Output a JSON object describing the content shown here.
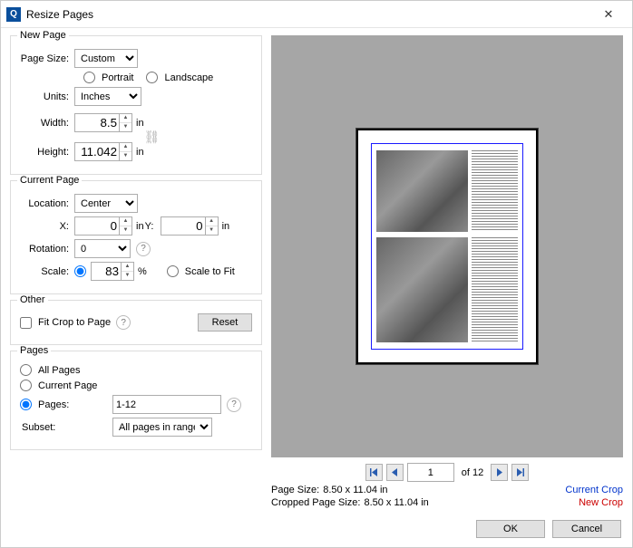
{
  "window": {
    "title": "Resize Pages"
  },
  "newPage": {
    "legend": "New Page",
    "pageSize_label": "Page Size:",
    "pageSize_value": "Custom",
    "portrait_label": "Portrait",
    "landscape_label": "Landscape",
    "units_label": "Units:",
    "units_value": "Inches",
    "width_label": "Width:",
    "width_value": "8.5",
    "width_unit": "in",
    "height_label": "Height:",
    "height_value": "11.042",
    "height_unit": "in"
  },
  "currentPage": {
    "legend": "Current Page",
    "location_label": "Location:",
    "location_value": "Center",
    "x_label": "X:",
    "x_value": "0",
    "x_unit": "in",
    "y_label": "Y:",
    "y_value": "0",
    "y_unit": "in",
    "rotation_label": "Rotation:",
    "rotation_value": "0",
    "scale_label": "Scale:",
    "scale_value": "83",
    "scale_unit": "%",
    "scaleToFit_label": "Scale to Fit"
  },
  "other": {
    "legend": "Other",
    "fitCrop_label": "Fit Crop to Page",
    "reset_label": "Reset"
  },
  "pages": {
    "legend": "Pages",
    "all_label": "All Pages",
    "current_label": "Current Page",
    "pages_label": "Pages:",
    "pages_value": "1-12",
    "subset_label": "Subset:",
    "subset_value": "All pages in range"
  },
  "preview": {
    "page_input": "1",
    "of_total": "of 12",
    "pageSize_key": "Page Size:",
    "pageSize_val": "8.50 x 11.04 in",
    "croppedPageSize_key": "Cropped Page Size:",
    "croppedPageSize_val": "8.50 x 11.04 in",
    "currentCrop": "Current Crop",
    "newCrop": "New Crop"
  },
  "footer": {
    "ok": "OK",
    "cancel": "Cancel"
  }
}
